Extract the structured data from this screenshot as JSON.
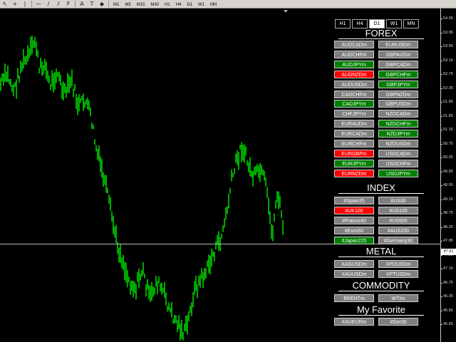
{
  "toolbar": {
    "icons": [
      "cursor-icon",
      "crosshair-icon",
      "vertical-line-icon",
      "horizontal-line-icon",
      "trendline-icon",
      "channel-icon",
      "fibo-icon",
      "text-icon",
      "label-icon",
      "shapes-icon"
    ],
    "glyphs": [
      "↖",
      "+",
      "|",
      "—",
      "/",
      "⫽",
      "F",
      "A",
      "T",
      "◆"
    ],
    "timeframes": [
      "M1",
      "M5",
      "M15",
      "M30",
      "H1",
      "H4",
      "D1",
      "W1",
      "MN"
    ]
  },
  "timeframes_panel": [
    "H1",
    "H4",
    "D1",
    "W1",
    "MN"
  ],
  "selected_timeframe": "D1",
  "sections": {
    "forex": "FOREX",
    "index": "INDEX",
    "metal": "METAL",
    "commodity": "COMMODITY",
    "favorite": "My Favorite"
  },
  "forex": [
    {
      "label": "AUDCADm",
      "color": "gray"
    },
    {
      "label": "EURUSDm",
      "color": "gray"
    },
    {
      "label": "AUDCHFm",
      "color": "gray"
    },
    {
      "label": "GBPAUDm",
      "color": "gray"
    },
    {
      "label": "AUDJPYm",
      "color": "green"
    },
    {
      "label": "GBPCADm",
      "color": "gray"
    },
    {
      "label": "AUDNZDm",
      "color": "red"
    },
    {
      "label": "GBPCHFm",
      "color": "green"
    },
    {
      "label": "AUDUSDm",
      "color": "gray"
    },
    {
      "label": "GBPJPYm",
      "color": "green"
    },
    {
      "label": "CADCHFm",
      "color": "gray"
    },
    {
      "label": "GBPNZDm",
      "color": "gray"
    },
    {
      "label": "CADJPYm",
      "color": "green"
    },
    {
      "label": "GBPUSDm",
      "color": "gray"
    },
    {
      "label": "CHFJPYm",
      "color": "gray"
    },
    {
      "label": "NZDCADm",
      "color": "gray"
    },
    {
      "label": "EURAUDm",
      "color": "gray"
    },
    {
      "label": "NZDCHFm",
      "color": "green"
    },
    {
      "label": "EURCADm",
      "color": "gray"
    },
    {
      "label": "NZDJPYm",
      "color": "green"
    },
    {
      "label": "EURCHFm",
      "color": "gray"
    },
    {
      "label": "NZDUSDm",
      "color": "gray"
    },
    {
      "label": "EURGBPm",
      "color": "red"
    },
    {
      "label": "USDCADm",
      "color": "gray"
    },
    {
      "label": "EURJPYm",
      "color": "green"
    },
    {
      "label": "USDCHFm",
      "color": "gray"
    },
    {
      "label": "EURNZDm",
      "color": "red"
    },
    {
      "label": "USDJPYm",
      "color": "green"
    }
  ],
  "index": [
    {
      "label": "#Spain35",
      "color": "gray"
    },
    {
      "label": "#US30",
      "color": "gray"
    },
    {
      "label": "#UK100",
      "color": "red"
    },
    {
      "label": "#US100",
      "color": "gray"
    },
    {
      "label": "#France40",
      "color": "gray"
    },
    {
      "label": "#US500",
      "color": "gray"
    },
    {
      "label": "#Euro50",
      "color": "gray"
    },
    {
      "label": "#AUS200",
      "color": "gray"
    },
    {
      "label": "#Japan225",
      "color": "green"
    },
    {
      "label": "#Germany30",
      "color": "gray"
    }
  ],
  "metal": [
    {
      "label": "XAGUSDm",
      "color": "gray"
    },
    {
      "label": "XPDUSDm",
      "color": "gray"
    },
    {
      "label": "XAUUSDm",
      "color": "gray"
    },
    {
      "label": "XPTUSDm",
      "color": "gray"
    }
  ],
  "commodity": [
    {
      "label": "BRENTm",
      "color": "gray"
    },
    {
      "label": "WTIm",
      "color": "gray"
    }
  ],
  "favorite": [
    {
      "label": "XAUEURm",
      "color": "gray"
    },
    {
      "label": "#Ger30",
      "color": "gray"
    }
  ],
  "price_axis": [
    "54.35",
    "53.95",
    "53.55",
    "53.15",
    "52.75",
    "52.35",
    "51.95",
    "51.55",
    "51.15",
    "50.75",
    "50.35",
    "49.95",
    "49.55",
    "49.15",
    "48.75",
    "48.35",
    "47.95",
    "47.55",
    "47.15",
    "46.75",
    "46.35",
    "45.95",
    "45.55"
  ],
  "current_price": "47.91",
  "colors": {
    "candle": "#00ff00",
    "gray_btn": "#7f7f7f",
    "green_btn": "#008000",
    "red_btn": "#ff0000",
    "background": "#000000"
  }
}
